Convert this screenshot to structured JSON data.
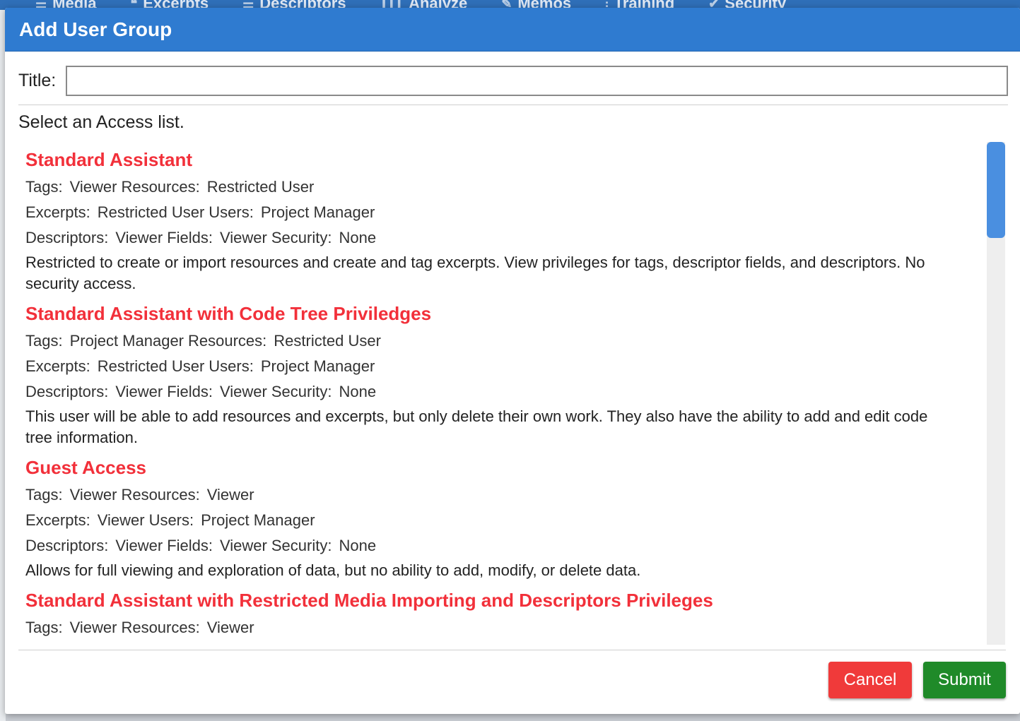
{
  "background_nav": {
    "items": [
      {
        "label": "Media",
        "icon": "list-icon"
      },
      {
        "label": "Excerpts",
        "icon": "quote-icon"
      },
      {
        "label": "Descriptors",
        "icon": "list-icon"
      },
      {
        "label": "Analyze",
        "icon": "barcode-icon"
      },
      {
        "label": "Memos",
        "icon": "edit-icon"
      },
      {
        "label": "Training",
        "icon": "sliders-icon"
      },
      {
        "label": "Security",
        "icon": "check-circle-icon"
      }
    ]
  },
  "dialog": {
    "title": "Add User Group",
    "title_label": "Title:",
    "title_value": "",
    "instruction": "Select an Access list.",
    "cancel_label": "Cancel",
    "submit_label": "Submit"
  },
  "access_lists": [
    {
      "name": "Standard Assistant",
      "lines": [
        [
          [
            "Tags:",
            "Viewer"
          ],
          [
            "Resources:",
            "Restricted User"
          ]
        ],
        [
          [
            "Excerpts:",
            "Restricted User"
          ],
          [
            "Users:",
            "Project Manager"
          ]
        ],
        [
          [
            "Descriptors:",
            "Viewer"
          ],
          [
            "Fields:",
            "Viewer"
          ],
          [
            "Security:",
            "None"
          ]
        ]
      ],
      "description": "Restricted to create or import resources and create and tag excerpts. View privileges for tags, descriptor fields, and descriptors. No security access."
    },
    {
      "name": "Standard Assistant with Code Tree Priviledges",
      "lines": [
        [
          [
            "Tags:",
            "Project Manager"
          ],
          [
            "Resources:",
            "Restricted User"
          ]
        ],
        [
          [
            "Excerpts:",
            "Restricted User"
          ],
          [
            "Users:",
            "Project Manager"
          ]
        ],
        [
          [
            "Descriptors:",
            "Viewer"
          ],
          [
            "Fields:",
            "Viewer"
          ],
          [
            "Security:",
            "None"
          ]
        ]
      ],
      "description": "This user will be able to add resources and excerpts, but only delete their own work. They also have the ability to add and edit code tree information."
    },
    {
      "name": "Guest Access",
      "lines": [
        [
          [
            "Tags:",
            "Viewer"
          ],
          [
            "Resources:",
            "Viewer"
          ]
        ],
        [
          [
            "Excerpts:",
            "Viewer"
          ],
          [
            "Users:",
            "Project Manager"
          ]
        ],
        [
          [
            "Descriptors:",
            "Viewer"
          ],
          [
            "Fields:",
            "Viewer"
          ],
          [
            "Security:",
            "None"
          ]
        ]
      ],
      "description": "Allows for full viewing and exploration of data, but no ability to add, modify, or delete data."
    },
    {
      "name": "Standard Assistant with Restricted Media Importing and Descriptors Privileges",
      "lines": [
        [
          [
            "Tags:",
            "Viewer"
          ],
          [
            "Resources:",
            "Viewer"
          ]
        ]
      ],
      "description": ""
    }
  ],
  "colors": {
    "header_blue": "#2f7bd0",
    "access_name_red": "#f2303a",
    "cancel_red": "#f03a3a",
    "submit_green": "#1f8a29",
    "scrollbar_blue": "#4a8fe0"
  }
}
